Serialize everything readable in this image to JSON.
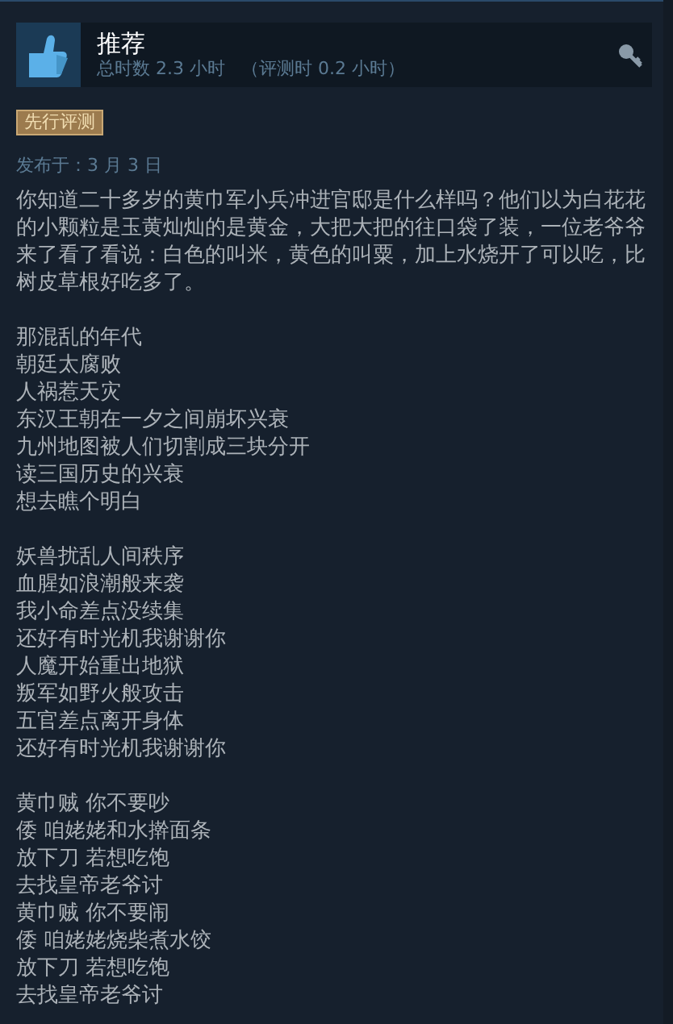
{
  "review": {
    "verdict": "推荐",
    "recommended": true,
    "hours": "总时数 2.3 小时",
    "review_hours": "（评测时 0.2 小时）",
    "badge": "先行评测",
    "posted": "发布于：3 月 3 日"
  },
  "paragraphs": [
    [
      "你知道二十多岁的黄巾军小兵冲进官邸是什么样吗？他们以为白花花的小颗粒是玉黄灿灿的是黄金，大把大把的往口袋了装，一位老爷爷来了看了看说：白色的叫米，黄色的叫粟，加上水烧开了可以吃，比树皮草根好吃多了。"
    ],
    [
      "那混乱的年代",
      "朝廷太腐败",
      "人祸惹天灾",
      "东汉王朝在一夕之间崩坏兴衰",
      "九州地图被人们切割成三块分开",
      "读三国历史的兴衰",
      "想去瞧个明白"
    ],
    [
      "妖兽扰乱人间秩序",
      "血腥如浪潮般来袭",
      "我小命差点没续集",
      "还好有时光机我谢谢你",
      "人魔开始重出地狱",
      "叛军如野火般攻击",
      "五官差点离开身体",
      "还好有时光机我谢谢你"
    ],
    [
      "黄巾贼 你不要吵",
      "倭 咱姥姥和水擀面条",
      "放下刀 若想吃饱",
      "去找皇帝老爷讨",
      "黄巾贼 你不要闹",
      "倭 咱姥姥烧柴煮水饺",
      "放下刀 若想吃饱",
      "去找皇帝老爷讨"
    ]
  ]
}
